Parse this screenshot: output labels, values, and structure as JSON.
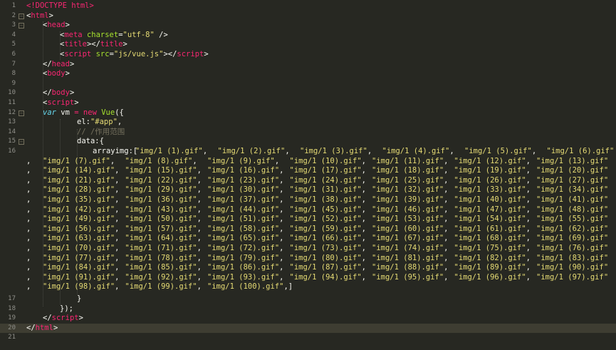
{
  "editor": {
    "line_numbers": [
      "1",
      "2",
      "3",
      "4",
      "5",
      "6",
      "7",
      "8",
      "9",
      "10",
      "11",
      "12",
      "13",
      "14",
      "15",
      "16",
      "17",
      "18",
      "19",
      "20",
      "21"
    ],
    "lines": {
      "l1": [
        "<!DOCTYPE html>"
      ],
      "l2_open": "<",
      "l2_tag": "html",
      "l2_close": ">",
      "l3_open": "<",
      "l3_tag": "head",
      "l3_close": ">",
      "l4_open": "<",
      "l4_tag": "meta",
      "l4_attr": "charset",
      "l4_eq": "=",
      "l4_val": "\"utf-8\"",
      "l4_end": " />",
      "l5_a": "<",
      "l5_tag1": "title",
      "l5_b": "></",
      "l5_tag2": "title",
      "l5_c": ">",
      "l6_a": "<",
      "l6_tag1": "script",
      "l6_attr": "src",
      "l6_eq": "=",
      "l6_val": "\"js/vue.js\"",
      "l6_b": "></",
      "l6_tag2": "script",
      "l6_c": ">",
      "l7_a": "</",
      "l7_tag": "head",
      "l7_c": ">",
      "l8_a": "<",
      "l8_tag": "body",
      "l8_c": ">",
      "l10_a": "</",
      "l10_tag": "body",
      "l10_c": ">",
      "l11_a": "<",
      "l11_tag": "script",
      "l11_c": ">",
      "l12_kw": "var",
      "l12_var": " vm ",
      "l12_eq": "=",
      "l12_new": "new",
      "l12_fn": " Vue",
      "l12_rest": "({",
      "l13_key": "el:",
      "l13_val": "\"#app\"",
      "l13_end": ",",
      "l14_comment": "// /作用范围",
      "l15_key": "data:{",
      "l16_key": "arrayimg:[",
      "l17": "}",
      "l18": "});",
      "l19_a": "</",
      "l19_tag": "script",
      "l19_c": ">",
      "l20_a": "</",
      "l20_tag": "html",
      "l20_c": ">"
    },
    "array_items": [
      "\"img/1 (1).gif\"",
      "\"img/1 (2).gif\"",
      "\"img/1 (3).gif\"",
      "\"img/1 (4).gif\"",
      "\"img/1 (5).gif\"",
      "\"img/1 (6).gif\"",
      "\"img/1 (7).gif\"",
      "\"img/1 (8).gif\"",
      "\"img/1 (9).gif\"",
      "\"img/1 (10).gif\"",
      "\"img/1 (11).gif\"",
      "\"img/1 (12).gif\"",
      "\"img/1 (13).gif\"",
      "\"img/1 (14).gif\"",
      "\"img/1 (15).gif\"",
      "\"img/1 (16).gif\"",
      "\"img/1 (17).gif\"",
      "\"img/1 (18).gif\"",
      "\"img/1 (19).gif\"",
      "\"img/1 (20).gif\"",
      "\"img/1 (21).gif\"",
      "\"img/1 (22).gif\"",
      "\"img/1 (23).gif\"",
      "\"img/1 (24).gif\"",
      "\"img/1 (25).gif\"",
      "\"img/1 (26).gif\"",
      "\"img/1 (27).gif\"",
      "\"img/1 (28).gif\"",
      "\"img/1 (29).gif\"",
      "\"img/1 (30).gif\"",
      "\"img/1 (31).gif\"",
      "\"img/1 (32).gif\"",
      "\"img/1 (33).gif\"",
      "\"img/1 (34).gif\"",
      "\"img/1 (35).gif\"",
      "\"img/1 (36).gif\"",
      "\"img/1 (37).gif\"",
      "\"img/1 (38).gif\"",
      "\"img/1 (39).gif\"",
      "\"img/1 (40).gif\"",
      "\"img/1 (41).gif\"",
      "\"img/1 (42).gif\"",
      "\"img/1 (43).gif\"",
      "\"img/1 (44).gif\"",
      "\"img/1 (45).gif\"",
      "\"img/1 (46).gif\"",
      "\"img/1 (47).gif\"",
      "\"img/1 (48).gif\"",
      "\"img/1 (49).gif\"",
      "\"img/1 (50).gif\"",
      "\"img/1 (51).gif\"",
      "\"img/1 (52).gif\"",
      "\"img/1 (53).gif\"",
      "\"img/1 (54).gif\"",
      "\"img/1 (55).gif\"",
      "\"img/1 (56).gif\"",
      "\"img/1 (57).gif\"",
      "\"img/1 (58).gif\"",
      "\"img/1 (59).gif\"",
      "\"img/1 (60).gif\"",
      "\"img/1 (61).gif\"",
      "\"img/1 (62).gif\"",
      "\"img/1 (63).gif\"",
      "\"img/1 (64).gif\"",
      "\"img/1 (65).gif\"",
      "\"img/1 (66).gif\"",
      "\"img/1 (67).gif\"",
      "\"img/1 (68).gif\"",
      "\"img/1 (69).gif\"",
      "\"img/1 (70).gif\"",
      "\"img/1 (71).gif\"",
      "\"img/1 (72).gif\"",
      "\"img/1 (73).gif\"",
      "\"img/1 (74).gif\"",
      "\"img/1 (75).gif\"",
      "\"img/1 (76).gif\"",
      "\"img/1 (77).gif\"",
      "\"img/1 (78).gif\"",
      "\"img/1 (79).gif\"",
      "\"img/1 (80).gif\"",
      "\"img/1 (81).gif\"",
      "\"img/1 (82).gif\"",
      "\"img/1 (83).gif\"",
      "\"img/1 (84).gif\"",
      "\"img/1 (85).gif\"",
      "\"img/1 (86).gif\"",
      "\"img/1 (87).gif\"",
      "\"img/1 (88).gif\"",
      "\"img/1 (89).gif\"",
      "\"img/1 (90).gif\"",
      "\"img/1 (91).gif\"",
      "\"img/1 (92).gif\"",
      "\"img/1 (93).gif\"",
      "\"img/1 (94).gif\"",
      "\"img/1 (95).gif\"",
      "\"img/1 (96).gif\"",
      "\"img/1 (97).gif\"",
      "\"img/1 (98).gif\"",
      "\"img/1 (99).gif\"",
      "\"img/1 (100).gif\""
    ],
    "array_close": "]",
    "separator": ",",
    "fold_marker": "−",
    "theme_colors": {
      "background": "#272822",
      "active_line": "#3e3d32",
      "tag": "#f92672",
      "attribute": "#a6e22e",
      "string": "#e6db74",
      "keyword": "#66d9ef",
      "comment": "#75715e",
      "text": "#f8f8f2",
      "line_number": "#90908a"
    }
  }
}
